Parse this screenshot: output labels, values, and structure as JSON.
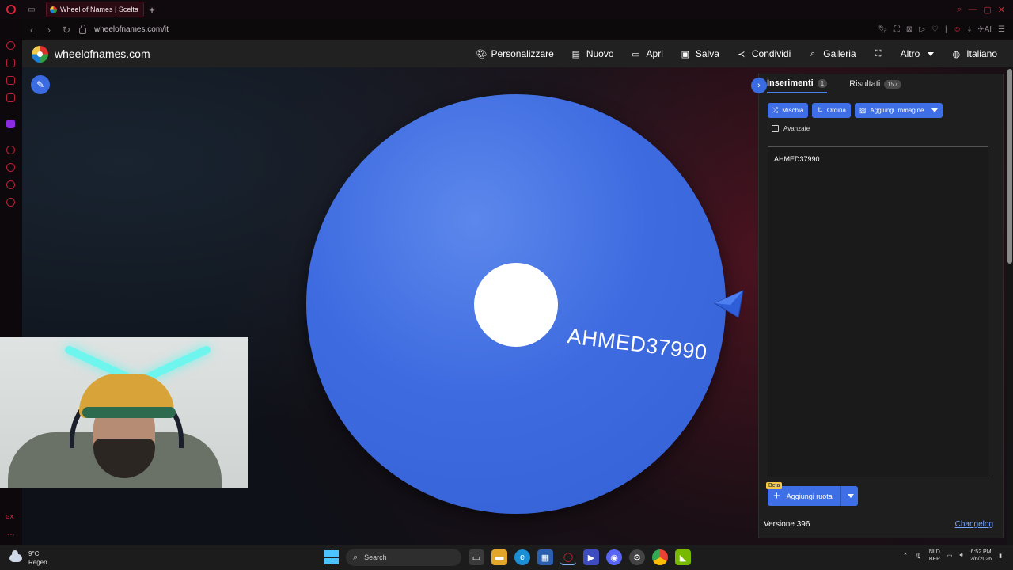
{
  "browser": {
    "tab_title": "Wheel of Names | Scelta c",
    "url": "wheelofnames.com/it",
    "ai_label": "AI"
  },
  "site": {
    "brand": "wheelofnames.com",
    "menu": [
      {
        "label": "Personalizzare",
        "icon": "palette-icon"
      },
      {
        "label": "Nuovo",
        "icon": "file-icon"
      },
      {
        "label": "Apri",
        "icon": "folder-open-icon"
      },
      {
        "label": "Salva",
        "icon": "save-icon"
      },
      {
        "label": "Condividi",
        "icon": "share-icon"
      },
      {
        "label": "Galleria",
        "icon": "search-icon"
      },
      {
        "label": "",
        "icon": "fullscreen-icon"
      },
      {
        "label": "Altro",
        "icon": "chevron-down-icon"
      },
      {
        "label": "Italiano",
        "icon": "globe-icon"
      }
    ]
  },
  "wheel": {
    "segment_label": "AHMED37990",
    "segment_color": "#3e6be0"
  },
  "panel": {
    "tab_entries": "Inserimenti",
    "tab_entries_count": "1",
    "tab_results": "Risultati",
    "tab_results_count": "157",
    "shuffle": "Mischia",
    "sort": "Ordina",
    "add_image": "Aggiungi immagine",
    "advanced": "Avanzate",
    "entries_text": "AHMED37990",
    "beta": "Beta",
    "add_wheel": "Aggiungi ruota",
    "version": "Versione 396",
    "changelog": "Changelog"
  },
  "taskbar": {
    "temp": "9°C",
    "weather": "Regen",
    "search_placeholder": "Search",
    "lang_top": "NLD",
    "lang_bottom": "BEP",
    "time": "6:52 PM",
    "date": "2/6/2026"
  },
  "colors": {
    "accent": "#3f6fe6",
    "gx_red": "#d8304a"
  }
}
